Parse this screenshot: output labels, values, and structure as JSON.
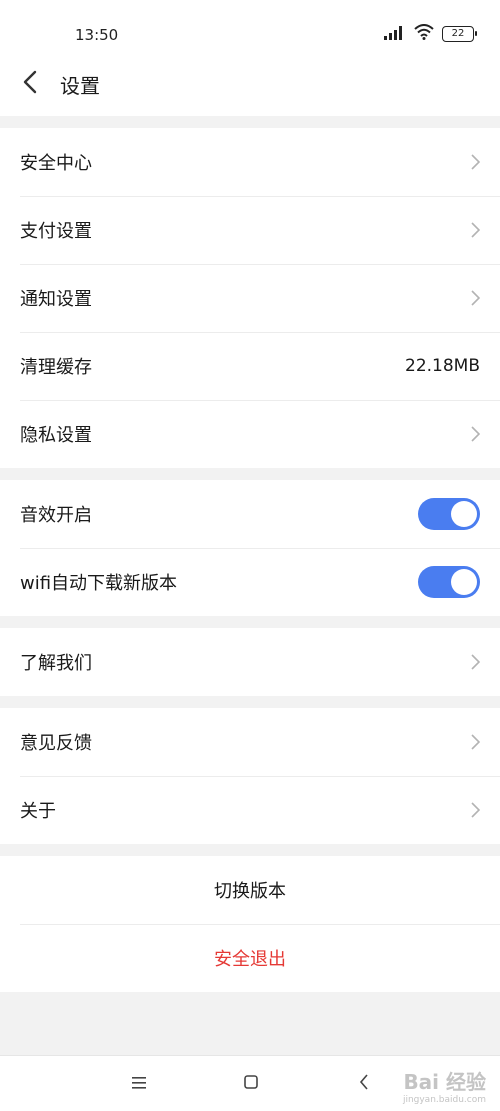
{
  "status": {
    "time": "13:50",
    "battery": "22"
  },
  "header": {
    "title": "设置"
  },
  "group1": [
    {
      "label": "安全中心"
    },
    {
      "label": "支付设置"
    },
    {
      "label": "通知设置"
    },
    {
      "label": "清理缓存",
      "value": "22.18MB"
    },
    {
      "label": "隐私设置"
    }
  ],
  "group2": [
    {
      "label": "音效开启",
      "on": true
    },
    {
      "label": "wifi自动下载新版本",
      "on": true
    }
  ],
  "group3": [
    {
      "label": "了解我们"
    }
  ],
  "group4": [
    {
      "label": "意见反馈"
    },
    {
      "label": "关于"
    }
  ],
  "actions": {
    "switch_version": "切换版本",
    "logout": "安全退出"
  },
  "watermark": {
    "main": "Bai 经验",
    "sub": "jingyan.baidu.com"
  },
  "colors": {
    "accent": "#4a7df0",
    "danger": "#e53935"
  },
  "icons": [
    "back-arrow-icon",
    "chevron-right-icon",
    "signal-icon",
    "wifi-icon",
    "battery-icon",
    "menu-icon",
    "home-square-icon",
    "nav-back-icon"
  ]
}
